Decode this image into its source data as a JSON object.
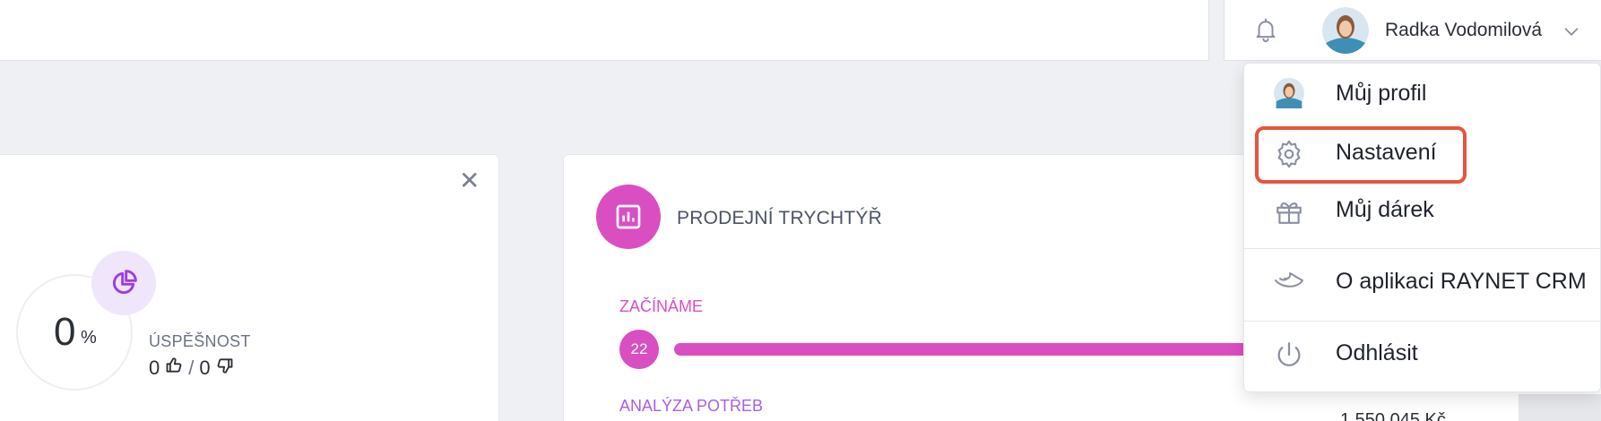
{
  "user": {
    "name": "Radka Vodomilová"
  },
  "dropdown": {
    "items": [
      {
        "label": "Můj profil",
        "icon": "avatar-icon"
      },
      {
        "label": "Nastavení",
        "icon": "gear-icon"
      },
      {
        "label": "Můj dárek",
        "icon": "gift-icon"
      },
      {
        "label": "O aplikaci RAYNET CRM",
        "icon": "raynet-logo-icon"
      },
      {
        "label": "Odhlásit",
        "icon": "power-icon"
      }
    ]
  },
  "success_widget": {
    "percent": "0",
    "percent_sign": "%",
    "label": "ÚSPĚŠNOST",
    "wins": "0",
    "separator": "/",
    "losses": "0"
  },
  "funnel": {
    "title": "PRODEJNÍ TRYCHTÝŘ",
    "stages": [
      {
        "label": "ZAČÍNÁME",
        "count": "22"
      },
      {
        "label": "ANALÝZA POTŘEB"
      }
    ],
    "partial_value": "1 550 045 Kč"
  },
  "colors": {
    "accent": "#d94fc2",
    "highlight": "#e5553f",
    "purple": "#a85ee6"
  }
}
